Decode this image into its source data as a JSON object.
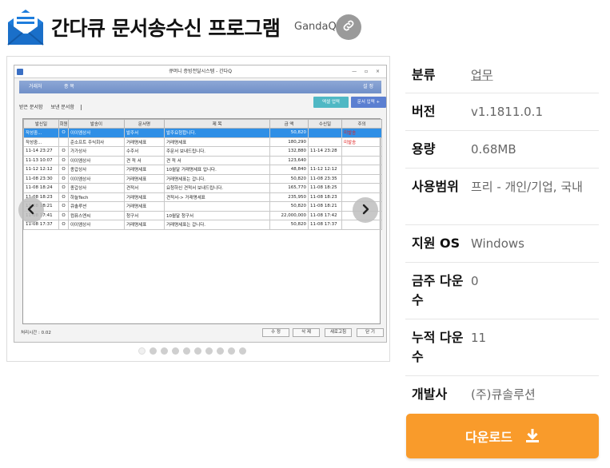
{
  "header": {
    "title": "간다큐 문서송수신 프로그램",
    "publisher": "GandaQ"
  },
  "screenshot": {
    "window_title": "큐머니 증빙전달시스템 - 간다Q",
    "menu_left": "거래처",
    "menu_mid": "종 목",
    "menu_right": "설 정",
    "tab_received": "받은 문서함",
    "tab_sent": "보낸 문서함",
    "btn_excel": "엑셀 업력",
    "btn_doc_input": "문서 입력 +",
    "columns": [
      "발신일",
      "회원",
      "발송이",
      "문서명",
      "제 목",
      "금 액",
      "수신일",
      "주의"
    ],
    "rows": [
      [
        "작성중...",
        "O",
        "이이엠상사",
        "발주서",
        "발주요청합니다.",
        "50,820",
        "",
        "미발송"
      ],
      [
        "작성중...",
        "",
        "준소프트 주식회사",
        "거래명세표",
        "거래명세표",
        "180,290",
        "",
        "미발송"
      ],
      [
        "11-14 23:27",
        "O",
        "가가상사",
        "수주서",
        "주문서 보내드립니다.",
        "132,880",
        "11-14 23:28",
        ""
      ],
      [
        "11-13 10:07",
        "O",
        "이이엠상사",
        "견 적 서",
        "견 적 서",
        "123,640",
        "",
        ""
      ],
      [
        "11-12 12:12",
        "O",
        "종갑상사",
        "거래명세표",
        "10월달 거래명세표 입니다.",
        "48,840",
        "11-12 12:12",
        ""
      ],
      [
        "11-08 23:30",
        "O",
        "이이엠상사",
        "거래명세표",
        "거래명세표는 갑니다.",
        "50,820",
        "11-08 23:35",
        ""
      ],
      [
        "11-08 18:24",
        "O",
        "종갑상사",
        "견적서",
        "요청하신 견적서 보내드립니다.",
        "165,770",
        "11-08 18:25",
        ""
      ],
      [
        "11-08 18:23",
        "O",
        "하늘Tech",
        "거래명세표",
        "견적서-> 거래명세표",
        "235,950",
        "11-08 18:23",
        ""
      ],
      [
        "11-08 18:21",
        "O",
        "큐솔루션",
        "거래명세표",
        "",
        "50,820",
        "11-08 18:21",
        ""
      ],
      [
        "11-08 17:41",
        "O",
        "컴퓨스엔씨",
        "청구서",
        "10월달 청구서",
        "22,000,000",
        "11-08 17:42",
        ""
      ],
      [
        "11-08 17:37",
        "O",
        "이이엠상사",
        "거래명세표",
        "거래명세표는 갑니다.",
        "50,820",
        "11-08 17:37",
        ""
      ]
    ],
    "status_text": "처리시간 : 0.02",
    "btn_edit": "수 정",
    "btn_delete": "삭 제",
    "btn_refresh": "새로고침",
    "btn_close": "닫 기"
  },
  "info": {
    "category_label": "분류",
    "category_value": "업무",
    "version_label": "버전",
    "version_value": "v1.1811.0.1",
    "size_label": "용량",
    "size_value": "0.68MB",
    "license_label": "사용범위",
    "license_value": "프리 - 개인/기업, 국내",
    "os_label": "지원 OS",
    "os_value": "Windows",
    "weekly_label": "금주 다운수",
    "weekly_value": "0",
    "total_label": "누적 다운수",
    "total_value": "11",
    "developer_label": "개발사",
    "developer_value": "(주)큐솔루션"
  },
  "download": {
    "label": "다운로드"
  },
  "colors": {
    "accent": "#f99b2b",
    "icon_blue": "#1e7ddc",
    "selection_blue": "#2f8fe6"
  },
  "icons": {
    "app": "envelope-icon",
    "link": "link-icon",
    "prev": "chevron-left-icon",
    "next": "chevron-right-icon",
    "download": "download-icon"
  }
}
